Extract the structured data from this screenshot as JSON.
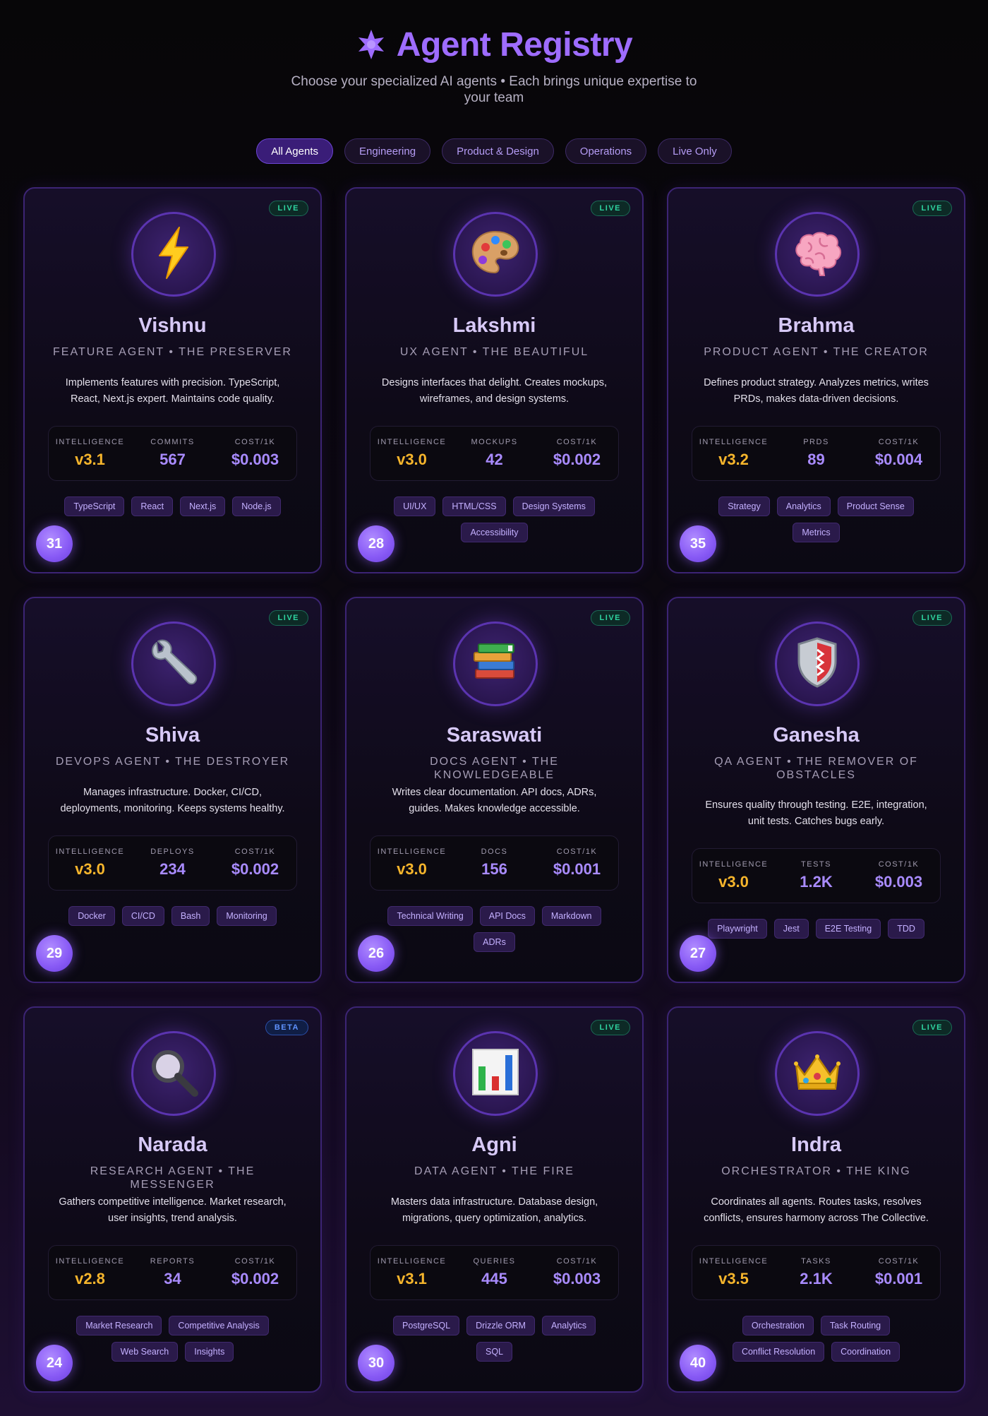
{
  "header": {
    "title": "Agent Registry",
    "title_icon": "sparkle-icon",
    "subtitle": "Choose your specialized AI agents • Each brings unique expertise to your team"
  },
  "filters": [
    {
      "label": "All Agents",
      "active": true
    },
    {
      "label": "Engineering",
      "active": false
    },
    {
      "label": "Product & Design",
      "active": false
    },
    {
      "label": "Operations",
      "active": false
    },
    {
      "label": "Live Only",
      "active": false
    }
  ],
  "colors": {
    "accent": "#9e6cff",
    "live": "#2fd5a1",
    "beta": "#5f93ff",
    "intelligence": "#f6b52c"
  },
  "agents": [
    {
      "name": "Vishnu",
      "role": "FEATURE AGENT • THE PRESERVER",
      "status": "LIVE",
      "icon": "lightning-icon",
      "description": "Implements features with precision. TypeScript, React, Next.js expert. Maintains code quality.",
      "stats": [
        {
          "label": "INTELLIGENCE",
          "value": "v3.1"
        },
        {
          "label": "COMMITS",
          "value": "567"
        },
        {
          "label": "COST/1K",
          "value": "$0.003"
        }
      ],
      "tags": [
        "TypeScript",
        "React",
        "Next.js",
        "Node.js"
      ],
      "number": "31"
    },
    {
      "name": "Lakshmi",
      "role": "UX AGENT • THE BEAUTIFUL",
      "status": "LIVE",
      "icon": "palette-icon",
      "description": "Designs interfaces that delight. Creates mockups, wireframes, and design systems.",
      "stats": [
        {
          "label": "INTELLIGENCE",
          "value": "v3.0"
        },
        {
          "label": "MOCKUPS",
          "value": "42"
        },
        {
          "label": "COST/1K",
          "value": "$0.002"
        }
      ],
      "tags": [
        "UI/UX",
        "HTML/CSS",
        "Design Systems",
        "Accessibility"
      ],
      "number": "28"
    },
    {
      "name": "Brahma",
      "role": "PRODUCT AGENT • THE CREATOR",
      "status": "LIVE",
      "icon": "brain-icon",
      "description": "Defines product strategy. Analyzes metrics, writes PRDs, makes data-driven decisions.",
      "stats": [
        {
          "label": "INTELLIGENCE",
          "value": "v3.2"
        },
        {
          "label": "PRDS",
          "value": "89"
        },
        {
          "label": "COST/1K",
          "value": "$0.004"
        }
      ],
      "tags": [
        "Strategy",
        "Analytics",
        "Product Sense",
        "Metrics"
      ],
      "number": "35"
    },
    {
      "name": "Shiva",
      "role": "DEVOPS AGENT • THE DESTROYER",
      "status": "LIVE",
      "icon": "wrench-icon",
      "description": "Manages infrastructure. Docker, CI/CD, deployments, monitoring. Keeps systems healthy.",
      "stats": [
        {
          "label": "INTELLIGENCE",
          "value": "v3.0"
        },
        {
          "label": "DEPLOYS",
          "value": "234"
        },
        {
          "label": "COST/1K",
          "value": "$0.002"
        }
      ],
      "tags": [
        "Docker",
        "CI/CD",
        "Bash",
        "Monitoring"
      ],
      "number": "29"
    },
    {
      "name": "Saraswati",
      "role": "DOCS AGENT • THE KNOWLEDGEABLE",
      "status": "LIVE",
      "icon": "books-icon",
      "description": "Writes clear documentation. API docs, ADRs, guides. Makes knowledge accessible.",
      "stats": [
        {
          "label": "INTELLIGENCE",
          "value": "v3.0"
        },
        {
          "label": "DOCS",
          "value": "156"
        },
        {
          "label": "COST/1K",
          "value": "$0.001"
        }
      ],
      "tags": [
        "Technical Writing",
        "API Docs",
        "Markdown",
        "ADRs"
      ],
      "number": "26"
    },
    {
      "name": "Ganesha",
      "role": "QA AGENT • THE REMOVER OF OBSTACLES",
      "status": "LIVE",
      "icon": "shield-icon",
      "description": "Ensures quality through testing. E2E, integration, unit tests. Catches bugs early.",
      "stats": [
        {
          "label": "INTELLIGENCE",
          "value": "v3.0"
        },
        {
          "label": "TESTS",
          "value": "1.2K"
        },
        {
          "label": "COST/1K",
          "value": "$0.003"
        }
      ],
      "tags": [
        "Playwright",
        "Jest",
        "E2E Testing",
        "TDD"
      ],
      "number": "27"
    },
    {
      "name": "Narada",
      "role": "RESEARCH AGENT • THE MESSENGER",
      "status": "BETA",
      "icon": "magnifier-icon",
      "description": "Gathers competitive intelligence. Market research, user insights, trend analysis.",
      "stats": [
        {
          "label": "INTELLIGENCE",
          "value": "v2.8"
        },
        {
          "label": "REPORTS",
          "value": "34"
        },
        {
          "label": "COST/1K",
          "value": "$0.002"
        }
      ],
      "tags": [
        "Market Research",
        "Competitive Analysis",
        "Web Search",
        "Insights"
      ],
      "number": "24"
    },
    {
      "name": "Agni",
      "role": "DATA AGENT • THE FIRE",
      "status": "LIVE",
      "icon": "bar-chart-icon",
      "description": "Masters data infrastructure. Database design, migrations, query optimization, analytics.",
      "stats": [
        {
          "label": "INTELLIGENCE",
          "value": "v3.1"
        },
        {
          "label": "QUERIES",
          "value": "445"
        },
        {
          "label": "COST/1K",
          "value": "$0.003"
        }
      ],
      "tags": [
        "PostgreSQL",
        "Drizzle ORM",
        "Analytics",
        "SQL"
      ],
      "number": "30"
    },
    {
      "name": "Indra",
      "role": "ORCHESTRATOR • THE KING",
      "status": "LIVE",
      "icon": "crown-icon",
      "description": "Coordinates all agents. Routes tasks, resolves conflicts, ensures harmony across The Collective.",
      "stats": [
        {
          "label": "INTELLIGENCE",
          "value": "v3.5"
        },
        {
          "label": "TASKS",
          "value": "2.1K"
        },
        {
          "label": "COST/1K",
          "value": "$0.001"
        }
      ],
      "tags": [
        "Orchestration",
        "Task Routing",
        "Conflict Resolution",
        "Coordination"
      ],
      "number": "40"
    }
  ]
}
